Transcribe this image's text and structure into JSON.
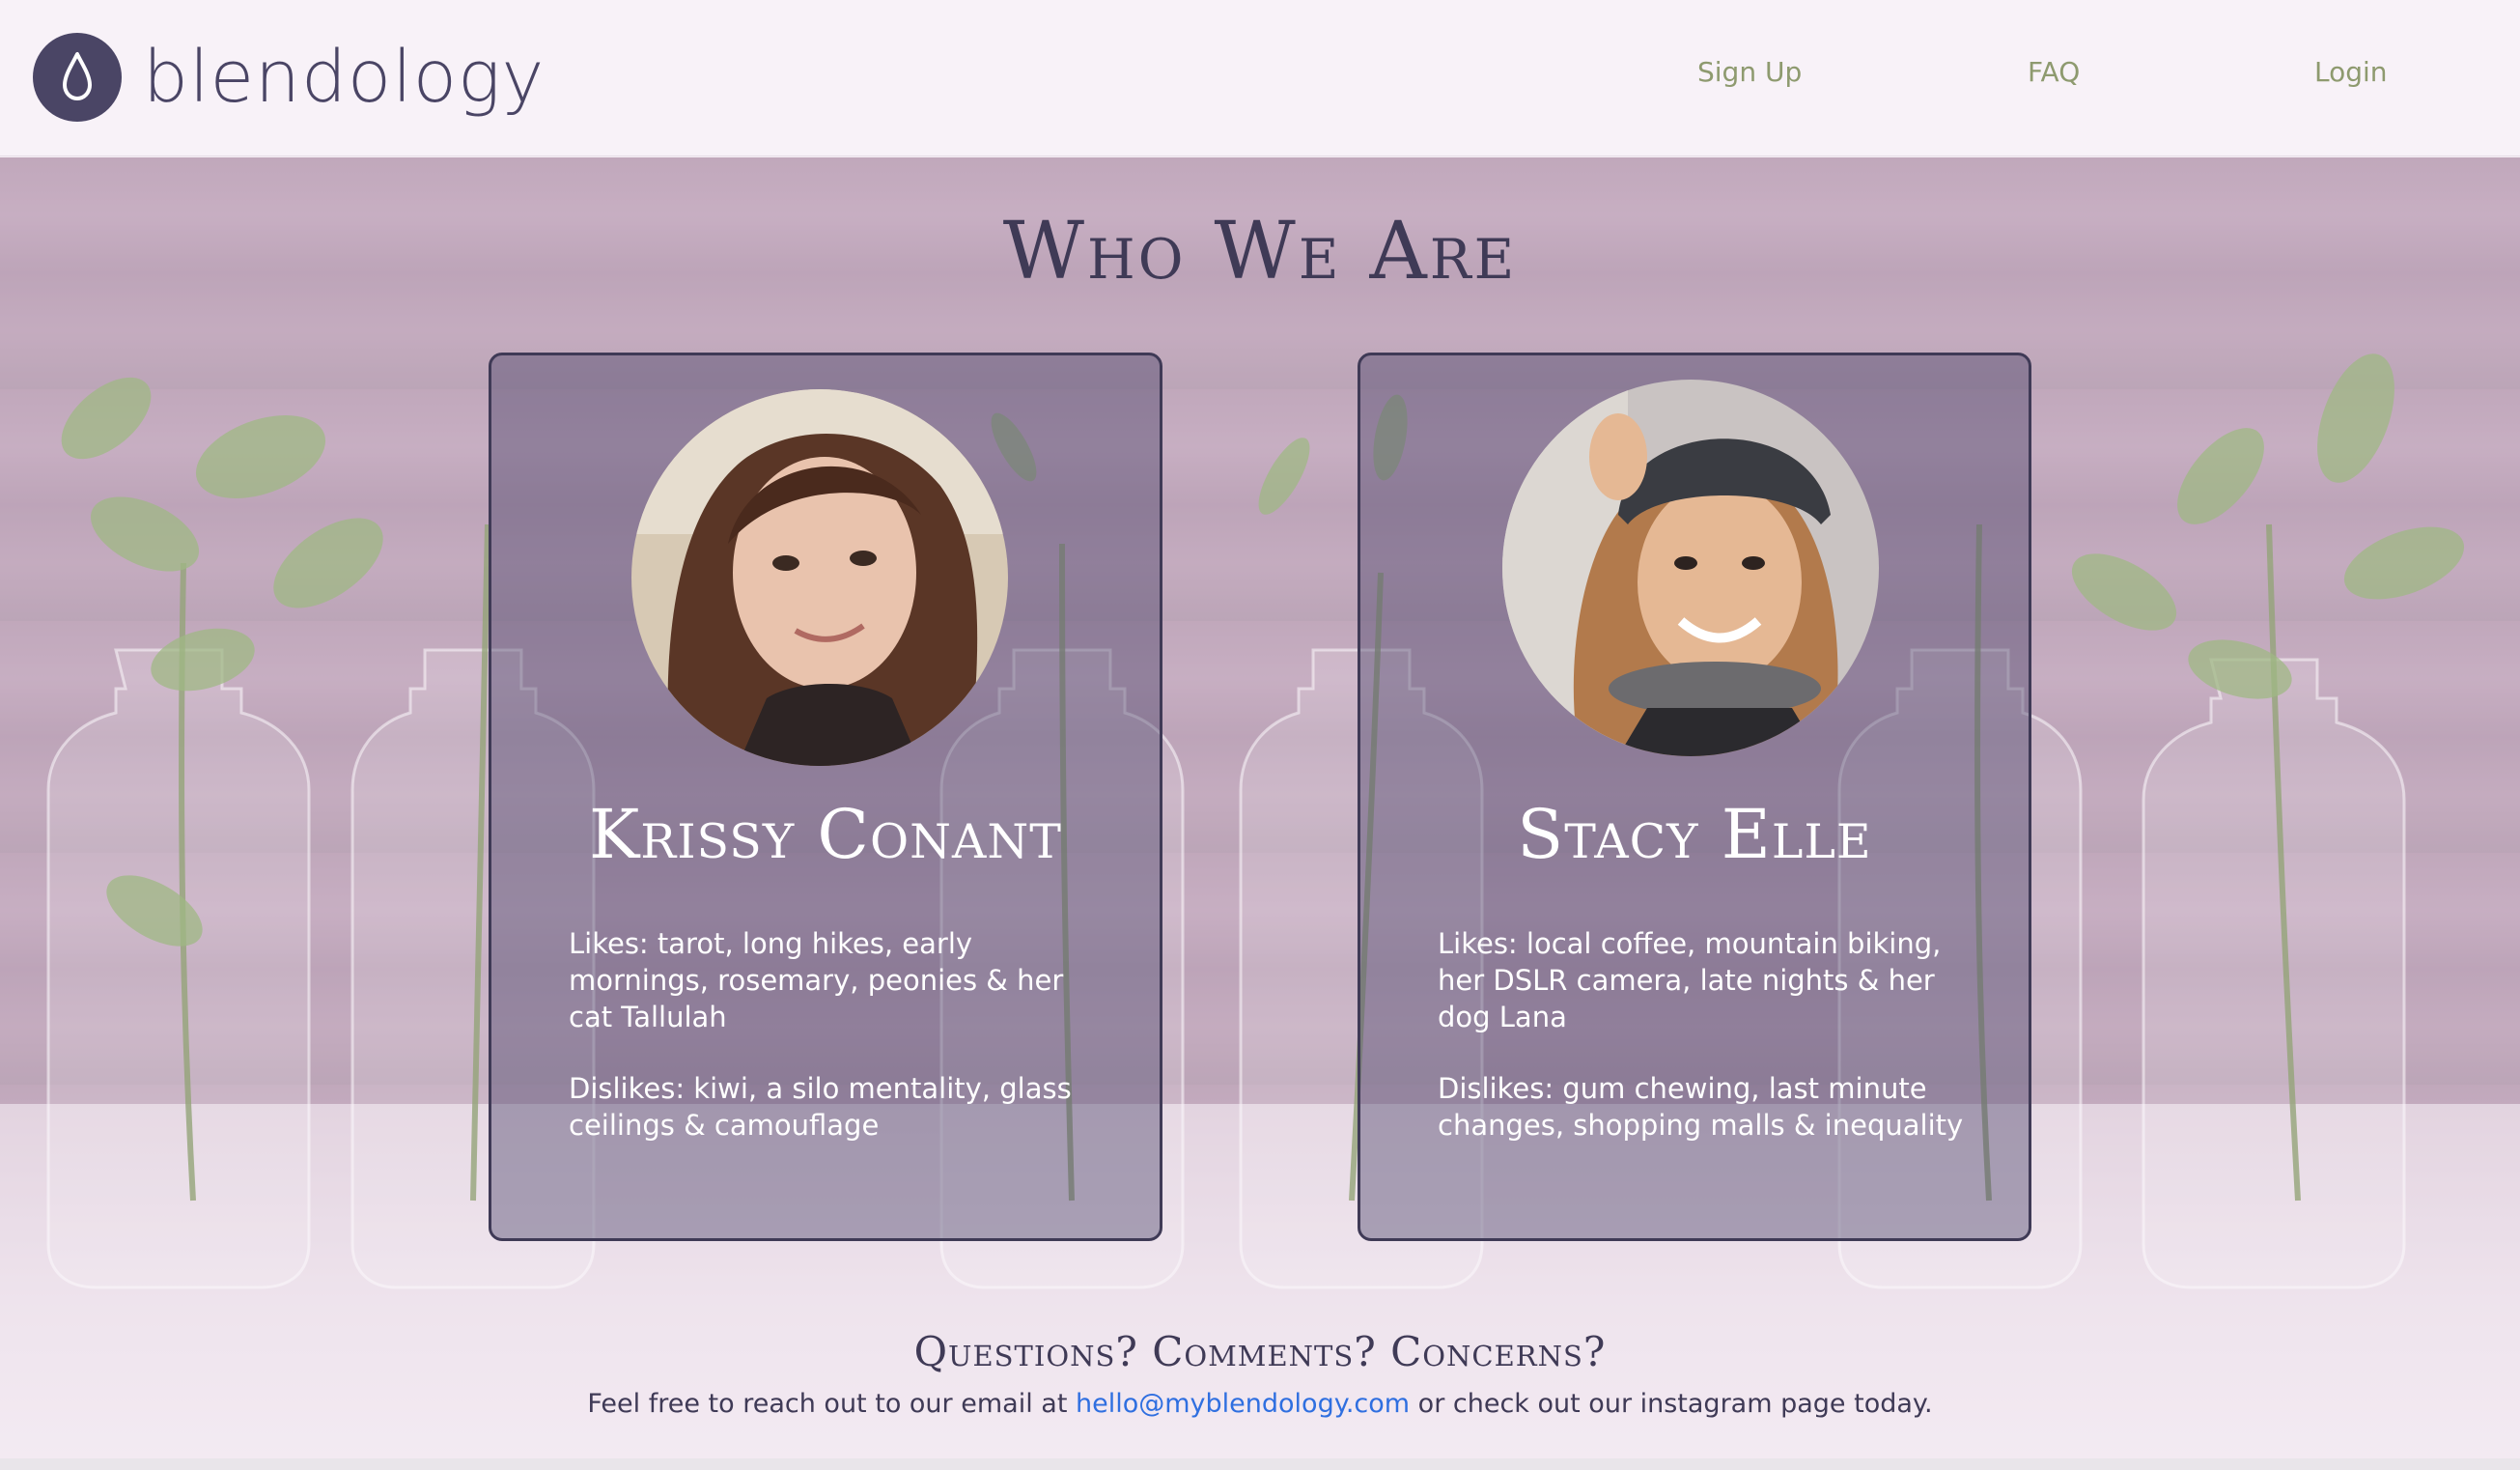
{
  "header": {
    "logo_text": "blendology",
    "nav": [
      "Sign Up",
      "FAQ",
      "Login"
    ]
  },
  "hero": {
    "title": "Who We Are",
    "members": [
      {
        "name": "Krissy Conant",
        "likes": "Likes: tarot, long hikes, early mornings, rosemary, peonies & her cat Tallulah",
        "dislikes": "Dislikes: kiwi, a silo mentality, glass ceilings & camouflage"
      },
      {
        "name": "Stacy Elle",
        "likes": "Likes: local coffee, mountain biking, her DSLR camera, late nights & her dog Lana",
        "dislikes": "Dislikes: gum chewing, last minute changes, shopping malls & inequality"
      }
    ]
  },
  "contact": {
    "title": "Questions? Comments? Concerns?",
    "text_before": "Feel free to reach out to our email at ",
    "email": "hello@myblendology.com",
    "text_after": " or check out our instagram page today."
  },
  "colors": {
    "brand": "#4a4565",
    "nav": "#8e9a6f",
    "link": "#2f6fe0",
    "card_border": "#3f3a56"
  },
  "icons": {
    "logo": "water-drop-icon"
  }
}
